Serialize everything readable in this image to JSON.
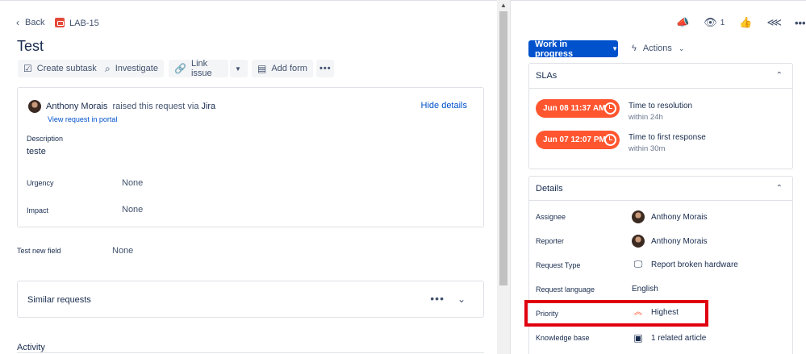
{
  "header": {
    "back_label": "Back",
    "issue_key": "LAB-15",
    "title": "Test",
    "watchers_count": "1"
  },
  "toolbar": {
    "create_subtask": "Create subtask",
    "investigate": "Investigate",
    "link_issue": "Link issue",
    "add_form": "Add form"
  },
  "request": {
    "reporter": "Anthony Morais",
    "raised_text": "raised this request via",
    "channel": "Jira",
    "portal_link": "View request in portal",
    "hide_details": "Hide details",
    "description_label": "Description",
    "description_value": "teste",
    "urgency_label": "Urgency",
    "urgency_value": "None",
    "impact_label": "Impact",
    "impact_value": "None"
  },
  "custom_field": {
    "label": "Test new field",
    "value": "None"
  },
  "similar": {
    "label": "Similar requests"
  },
  "activity": {
    "label": "Activity"
  },
  "status": {
    "label": "Work in progress",
    "actions_label": "Actions"
  },
  "slas": {
    "title": "SLAs",
    "items": [
      {
        "time": "Jun 08 11:37 AM",
        "name": "Time to resolution",
        "goal": "within 24h"
      },
      {
        "time": "Jun 07 12:07 PM",
        "name": "Time to first response",
        "goal": "within 30m"
      }
    ]
  },
  "details": {
    "title": "Details",
    "assignee_label": "Assignee",
    "assignee": "Anthony Morais",
    "reporter_label": "Reporter",
    "reporter": "Anthony Morais",
    "request_type_label": "Request Type",
    "request_type": "Report broken hardware",
    "language_label": "Request language",
    "language": "English",
    "priority_label": "Priority",
    "priority": "Highest",
    "kb_label": "Knowledge base",
    "kb_value": "1 related article"
  },
  "colors": {
    "primary": "#0052cc",
    "sla_breached": "#ff5630",
    "priority_highest": "#ff5630",
    "highlight": "#e0000f"
  }
}
